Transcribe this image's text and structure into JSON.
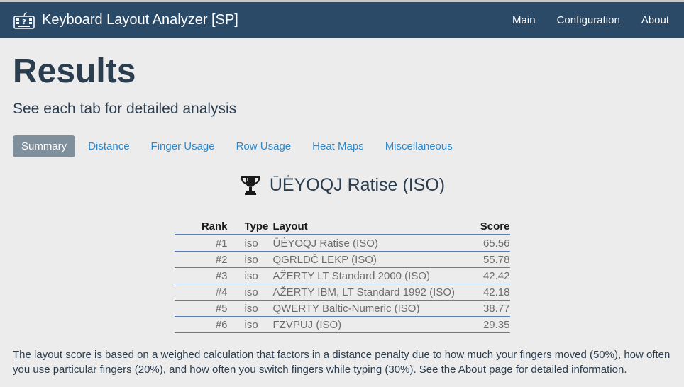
{
  "app": {
    "title": "Keyboard Layout Analyzer [SP]"
  },
  "nav": {
    "items": [
      "Main",
      "Configuration",
      "About"
    ]
  },
  "page": {
    "title": "Results",
    "subtitle": "See each tab for detailed analysis"
  },
  "tabs": [
    {
      "label": "Summary",
      "active": true
    },
    {
      "label": "Distance",
      "active": false
    },
    {
      "label": "Finger Usage",
      "active": false
    },
    {
      "label": "Row Usage",
      "active": false
    },
    {
      "label": "Heat Maps",
      "active": false
    },
    {
      "label": "Miscellaneous",
      "active": false
    }
  ],
  "winner": {
    "icon": "trophy-icon",
    "name": "ŪĖYOQJ Ratise (ISO)"
  },
  "table": {
    "headers": {
      "rank": "Rank",
      "type": "Type",
      "layout": "Layout",
      "score": "Score"
    },
    "rows": [
      {
        "rank": "#1",
        "type": "iso",
        "layout": "ŪĖYOQJ Ratise (ISO)",
        "score": "65.56"
      },
      {
        "rank": "#2",
        "type": "iso",
        "layout": "QGRLDČ LEKP (ISO)",
        "score": "55.78"
      },
      {
        "rank": "#3",
        "type": "iso",
        "layout": "AŽERTY LT Standard 2000 (ISO)",
        "score": "42.42"
      },
      {
        "rank": "#4",
        "type": "iso",
        "layout": "AŽERTY IBM, LT Standard 1992 (ISO)",
        "score": "42.18"
      },
      {
        "rank": "#5",
        "type": "iso",
        "layout": "QWERTY Baltic-Numeric (ISO)",
        "score": "38.77"
      },
      {
        "rank": "#6",
        "type": "iso",
        "layout": "FZVPUJ (ISO)",
        "score": "29.35"
      }
    ]
  },
  "footnote": "The layout score is based on a weighed calculation that factors in a distance penalty due to how much your fingers moved (50%), how often you use particular fingers (20%), and how often you switch fingers while typing (30%). See the About page for detailed information.",
  "colors": {
    "navbar": "#2b4a68",
    "link": "#2a8ad0",
    "active_tab": "#7f8f9c",
    "text": "#2b3e50"
  }
}
